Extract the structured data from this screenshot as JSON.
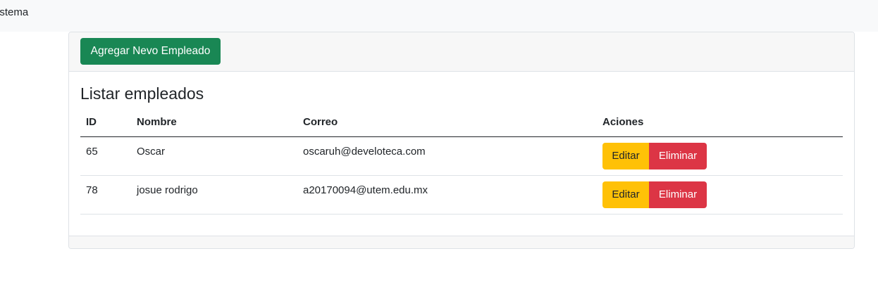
{
  "navbar": {
    "brand": "Sistema"
  },
  "header": {
    "add_button_label": "Agregar Nevo Empleado"
  },
  "main": {
    "title": "Listar empleados",
    "columns": [
      "ID",
      "Nombre",
      "Correo",
      "Aciones"
    ],
    "rows": [
      {
        "id": "65",
        "nombre": "Oscar",
        "correo": "oscaruh@develoteca.com",
        "edit_label": "Editar",
        "delete_label": "Eliminar"
      },
      {
        "id": "78",
        "nombre": "josue rodrigo",
        "correo": "a20170094@utem.edu.mx",
        "edit_label": "Editar",
        "delete_label": "Eliminar"
      }
    ]
  },
  "colors": {
    "add_button": "#198754",
    "edit_button": "#ffc107",
    "delete_button": "#dc3545"
  }
}
